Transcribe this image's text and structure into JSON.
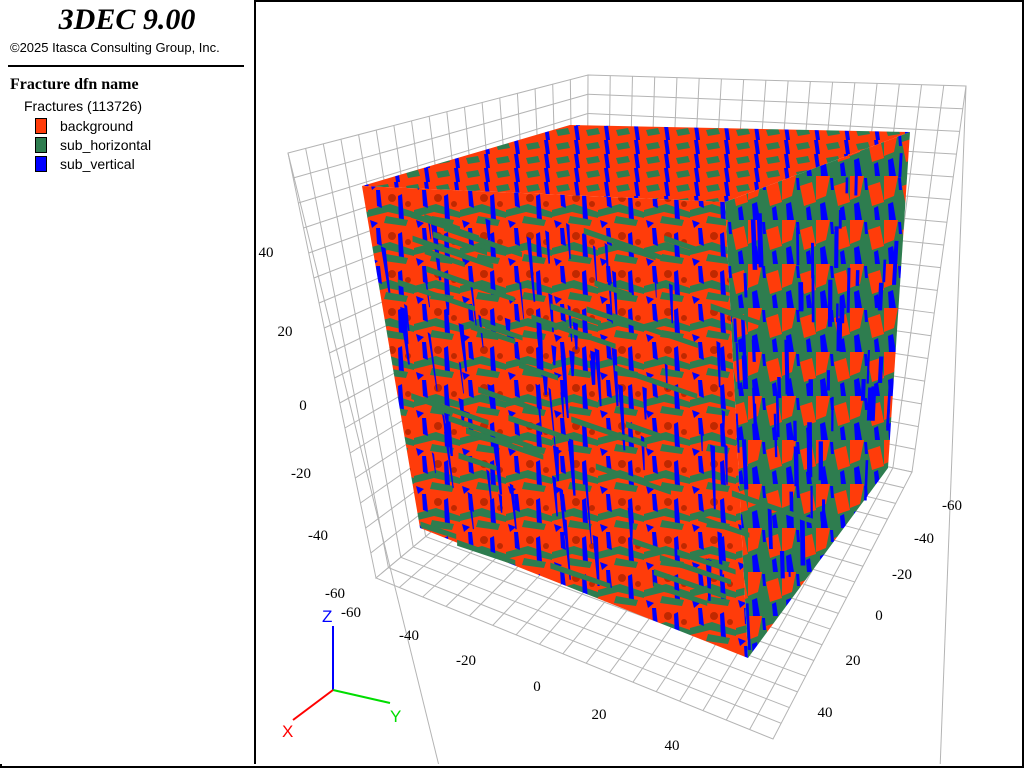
{
  "app": {
    "title": "3DEC 9.00",
    "copyright": "©2025 Itasca Consulting Group, Inc."
  },
  "legend": {
    "heading": "Fracture dfn name",
    "group_label": "Fractures (113726)",
    "items": [
      {
        "label": "background",
        "color": "#ff3c0a"
      },
      {
        "label": "sub_horizontal",
        "color": "#2e7d4f"
      },
      {
        "label": "sub_vertical",
        "color": "#0000ff"
      }
    ]
  },
  "axes": {
    "z_ticks": [
      "40",
      "20",
      "0",
      "-20",
      "-40",
      "-60"
    ],
    "x_ticks": [
      "-60",
      "-40",
      "-20",
      "0",
      "20",
      "40"
    ],
    "y_ticks": [
      "-60",
      "-40",
      "-20",
      "0",
      "20",
      "40"
    ],
    "triad": {
      "x": "X",
      "y": "Y",
      "z": "Z"
    },
    "colors": {
      "x": "#ff0000",
      "y": "#00dd00",
      "z": "#0000ff",
      "grid": "#b4b4b4"
    }
  }
}
